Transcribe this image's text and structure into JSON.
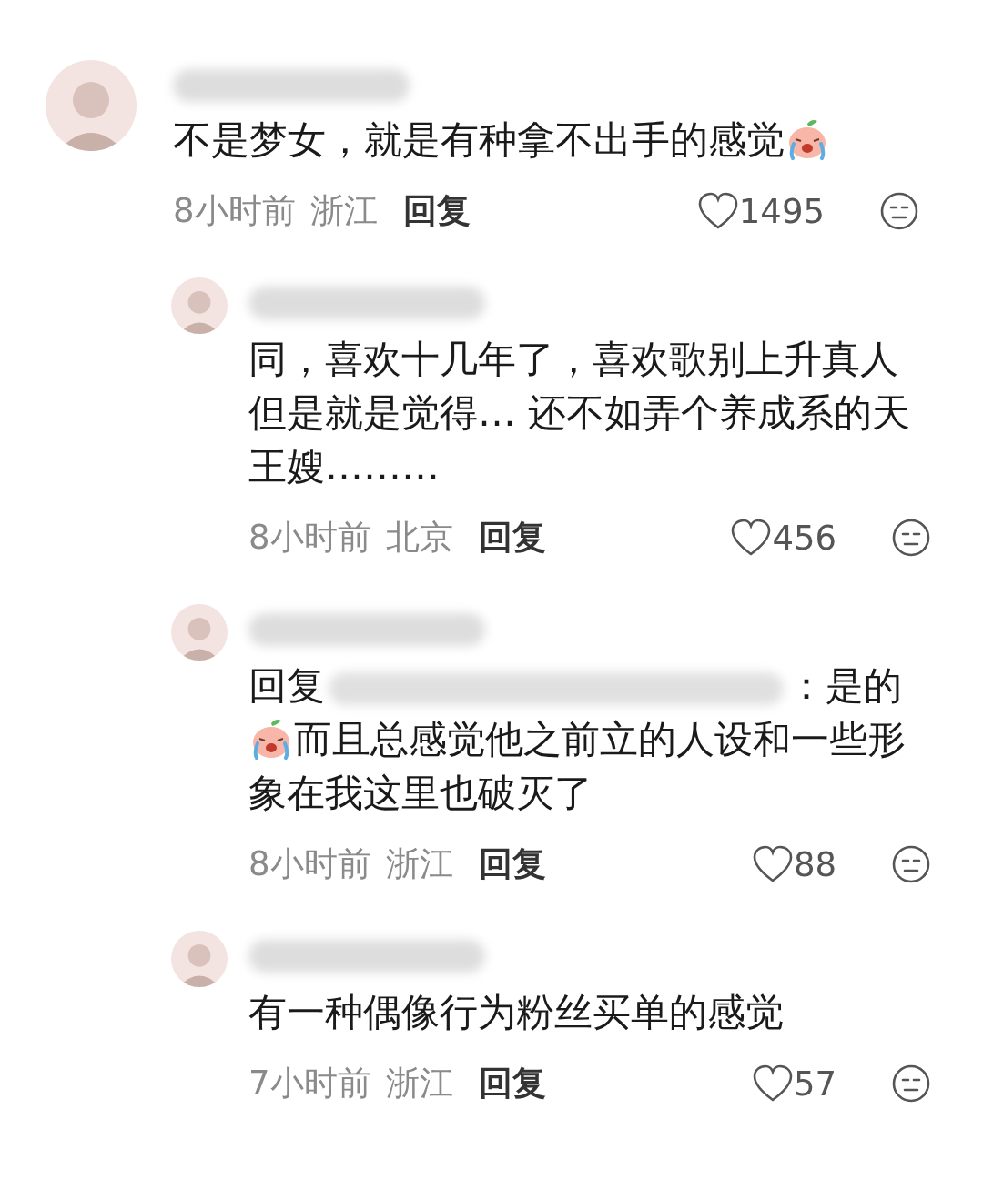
{
  "comments": [
    {
      "reply": false,
      "content": [
        {
          "kind": "text",
          "text": "不是梦女，就是有种拿不出手的感觉"
        },
        {
          "kind": "emoji"
        }
      ],
      "time": "8小时前",
      "location": "浙江",
      "reply_label": "回复",
      "likes": "1495"
    },
    {
      "reply": true,
      "content": [
        {
          "kind": "text",
          "text": "同，喜欢十几年了，喜欢歌别上升真人但是就是觉得… 还不如弄个养成系的天王嫂………"
        }
      ],
      "time": "8小时前",
      "location": "北京",
      "reply_label": "回复",
      "likes": "456"
    },
    {
      "reply": true,
      "content": [
        {
          "kind": "text",
          "text": "回复"
        },
        {
          "kind": "blur"
        },
        {
          "kind": "text",
          "text": "：是的"
        },
        {
          "kind": "emoji"
        },
        {
          "kind": "text",
          "text": "而且总感觉他之前立的人设和一些形象在我这里也破灭了"
        }
      ],
      "time": "8小时前",
      "location": "浙江",
      "reply_label": "回复",
      "likes": "88"
    },
    {
      "reply": true,
      "content": [
        {
          "kind": "text",
          "text": "有一种偶像行为粉丝买单的感觉"
        }
      ],
      "time": "7小时前",
      "location": "浙江",
      "reply_label": "回复",
      "likes": "57"
    }
  ]
}
